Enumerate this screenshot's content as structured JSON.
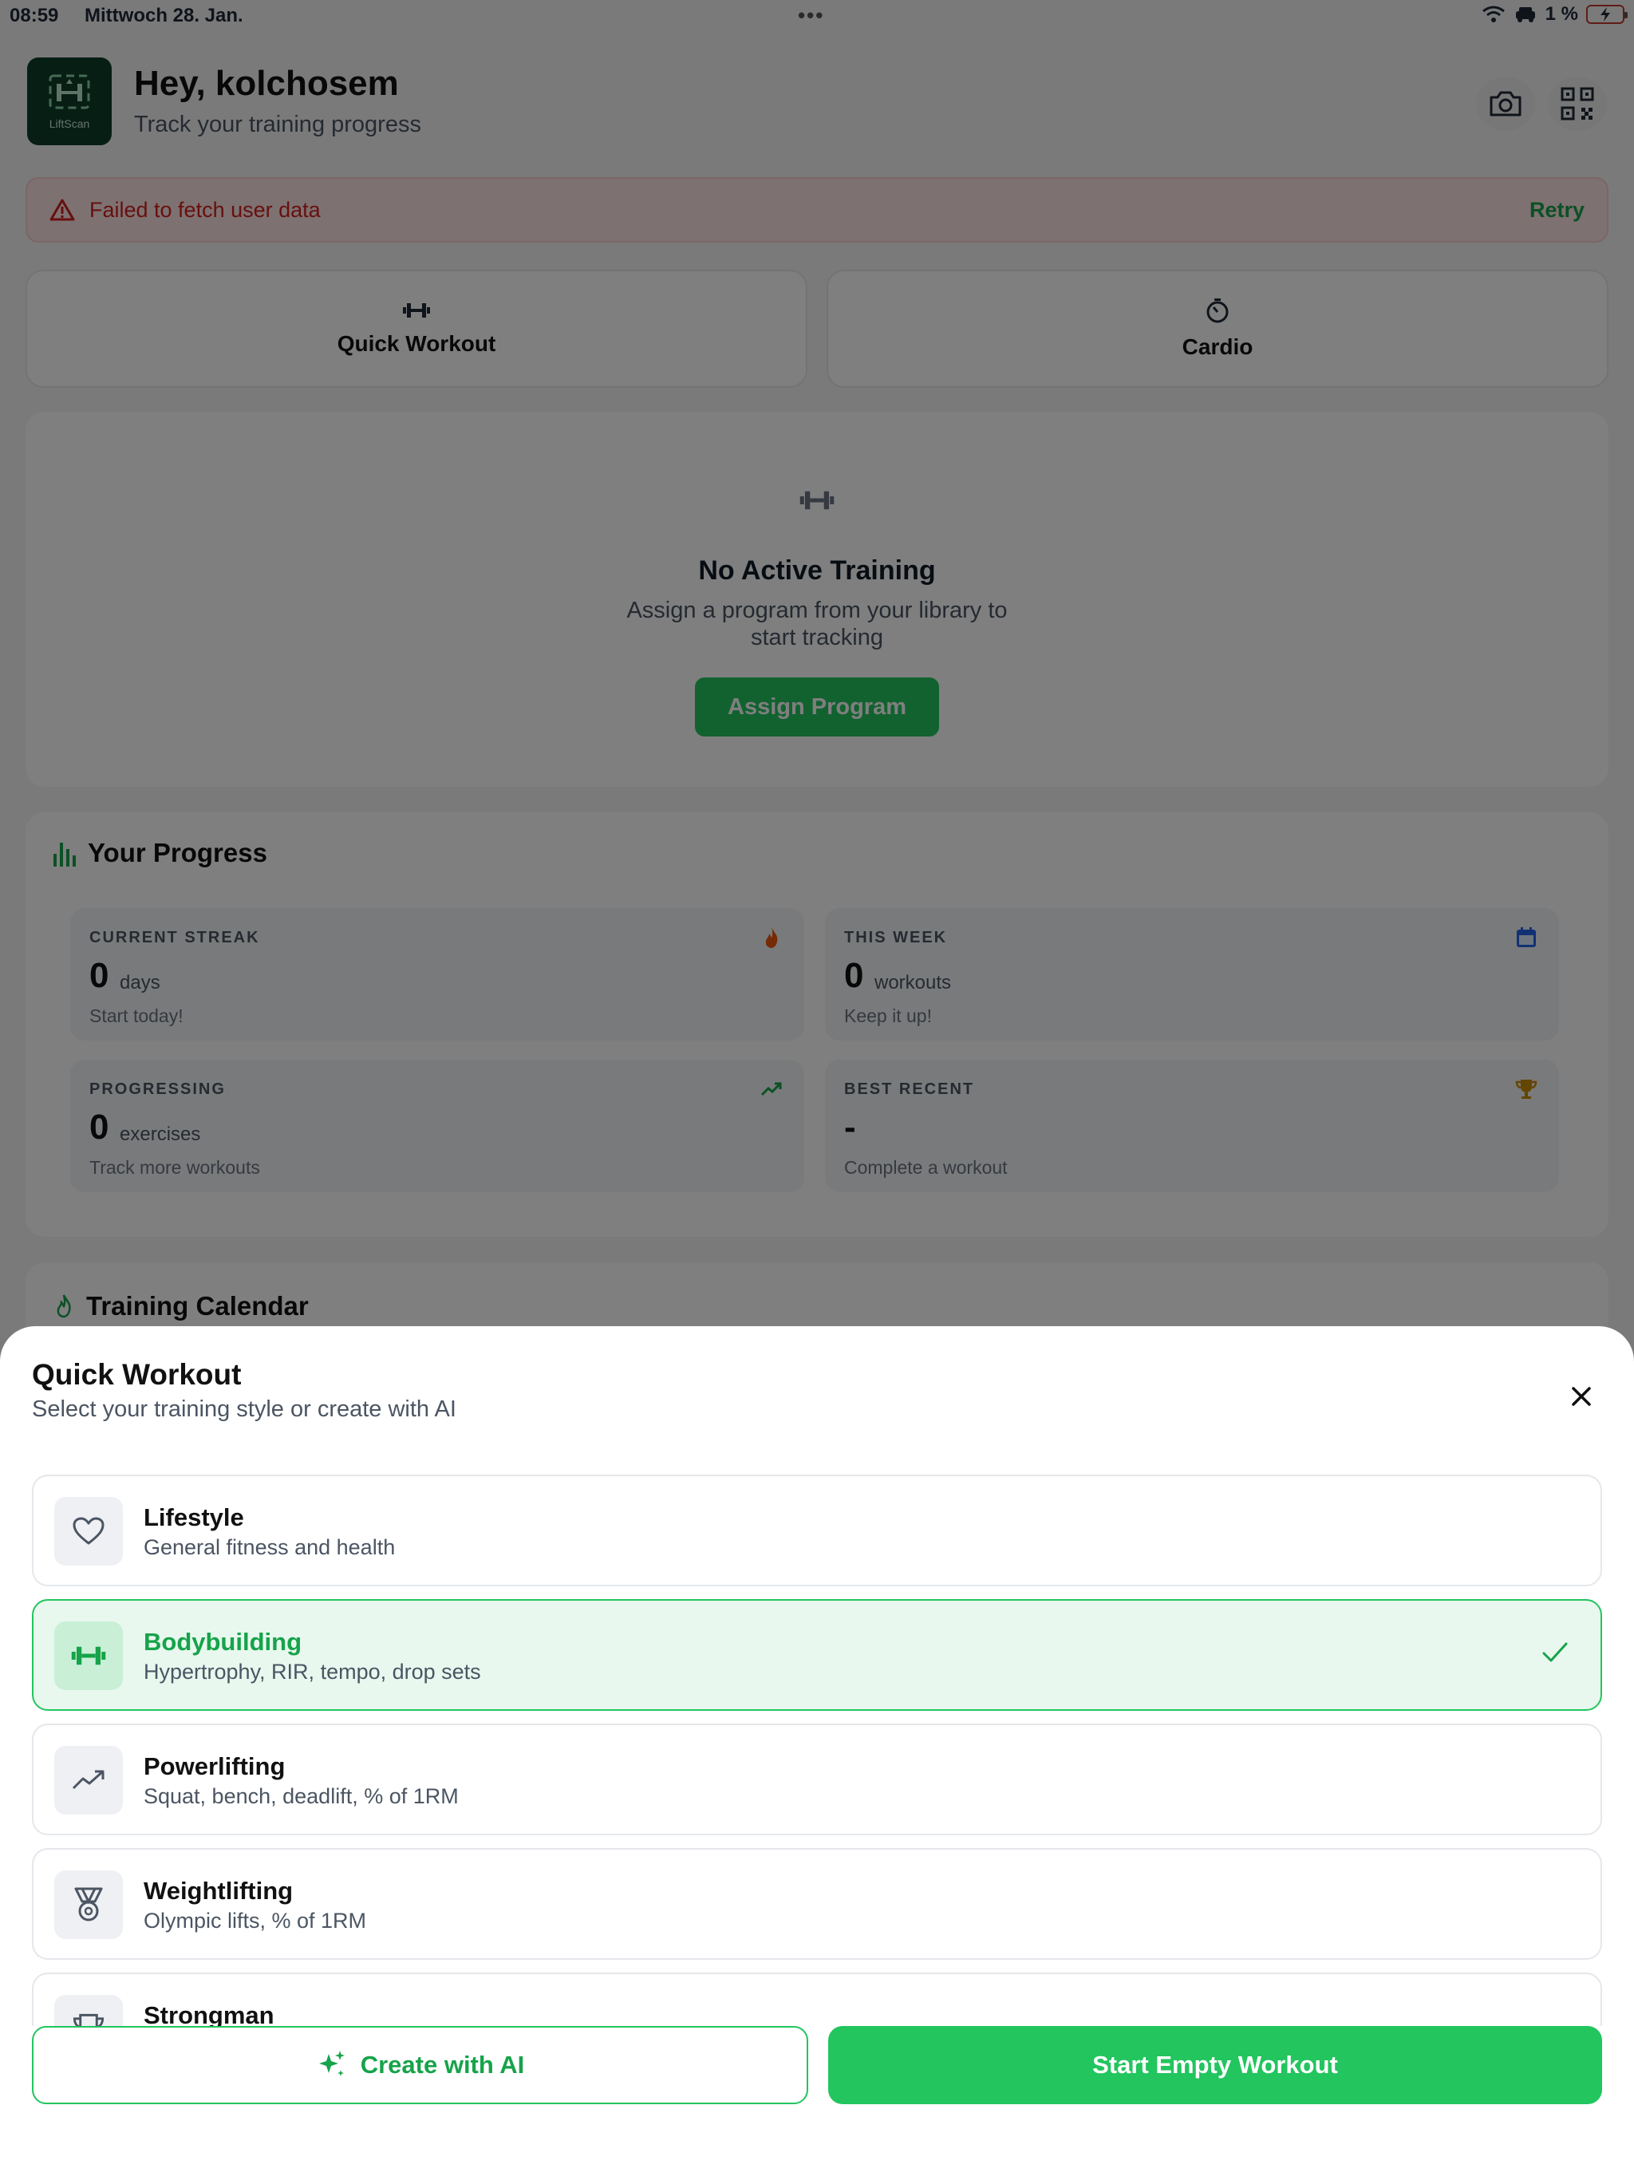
{
  "status_bar": {
    "time": "08:59",
    "date": "Mittwoch 28. Jan.",
    "battery": "1 %"
  },
  "header": {
    "logo_text": "LiftScan",
    "greeting": "Hey, kolchosem",
    "subtitle": "Track your training progress"
  },
  "error_banner": {
    "message": "Failed to fetch user data",
    "retry_label": "Retry"
  },
  "quick_actions": {
    "quick_workout": "Quick Workout",
    "cardio": "Cardio"
  },
  "no_active_training": {
    "title": "No Active Training",
    "line1": "Assign a program from your library to",
    "line2": "start tracking",
    "button": "Assign Program"
  },
  "progress": {
    "title": "Your Progress",
    "stats": [
      {
        "caption": "CURRENT STREAK",
        "value": "0",
        "unit": "days",
        "note": "Start today!",
        "icon": "flame-icon",
        "color": "#ea580c"
      },
      {
        "caption": "THIS WEEK",
        "value": "0",
        "unit": "workouts",
        "note": "Keep it up!",
        "icon": "calendar-icon",
        "color": "#2563eb"
      },
      {
        "caption": "PROGRESSING",
        "value": "0",
        "unit": "exercises",
        "note": "Track more workouts",
        "icon": "trend-up-icon",
        "color": "#16a34a"
      },
      {
        "caption": "BEST RECENT",
        "value": "-",
        "unit": "",
        "note": "Complete a workout",
        "icon": "trophy-icon",
        "color": "#ca8a04"
      }
    ]
  },
  "calendar": {
    "title": "Training Calendar"
  },
  "sheet": {
    "title": "Quick Workout",
    "subtitle": "Select your training style or create with AI",
    "options": [
      {
        "name": "Lifestyle",
        "desc": "General fitness and health",
        "icon": "heart-icon",
        "selected": false
      },
      {
        "name": "Bodybuilding",
        "desc": "Hypertrophy, RIR, tempo, drop sets",
        "icon": "dumbbell-icon",
        "selected": true
      },
      {
        "name": "Powerlifting",
        "desc": "Squat, bench, deadlift, % of 1RM",
        "icon": "trend-up-icon",
        "selected": false
      },
      {
        "name": "Weightlifting",
        "desc": "Olympic lifts, % of 1RM",
        "icon": "medal-icon",
        "selected": false
      },
      {
        "name": "Strongman",
        "desc": "",
        "icon": "trophy-icon",
        "selected": false
      }
    ],
    "create_ai_label": "Create with AI",
    "start_empty_label": "Start Empty Workout"
  },
  "colors": {
    "accent": "#22c55e",
    "error": "#d01f1f"
  }
}
